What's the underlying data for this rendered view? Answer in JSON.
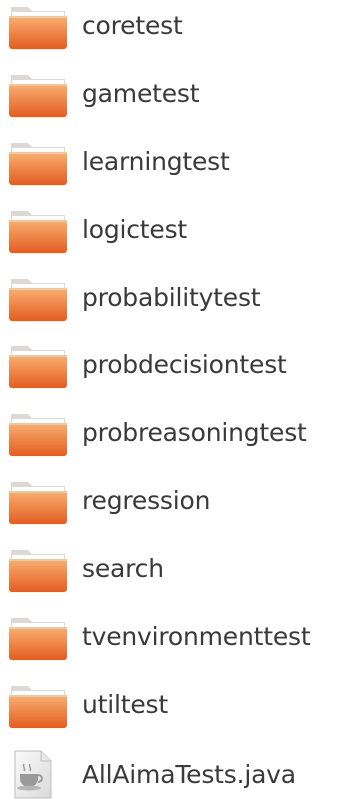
{
  "files": [
    {
      "name": "coretest",
      "type": "folder",
      "icon": "folder-icon"
    },
    {
      "name": "gametest",
      "type": "folder",
      "icon": "folder-icon"
    },
    {
      "name": "learningtest",
      "type": "folder",
      "icon": "folder-icon"
    },
    {
      "name": "logictest",
      "type": "folder",
      "icon": "folder-icon"
    },
    {
      "name": "probabilitytest",
      "type": "folder",
      "icon": "folder-icon"
    },
    {
      "name": "probdecisiontest",
      "type": "folder",
      "icon": "folder-icon"
    },
    {
      "name": "probreasoningtest",
      "type": "folder",
      "icon": "folder-icon"
    },
    {
      "name": "regression",
      "type": "folder",
      "icon": "folder-icon"
    },
    {
      "name": "search",
      "type": "folder",
      "icon": "folder-icon"
    },
    {
      "name": "tvenvironmenttest",
      "type": "folder",
      "icon": "folder-icon"
    },
    {
      "name": "utiltest",
      "type": "folder",
      "icon": "folder-icon"
    },
    {
      "name": "AllAimaTests.java",
      "type": "java-file",
      "icon": "java-file-icon"
    }
  ],
  "colors": {
    "folder_top": "#f7a35c",
    "folder_bottom": "#e8632a",
    "folder_tab": "#e9e7e3",
    "text": "#3a3a3a"
  }
}
